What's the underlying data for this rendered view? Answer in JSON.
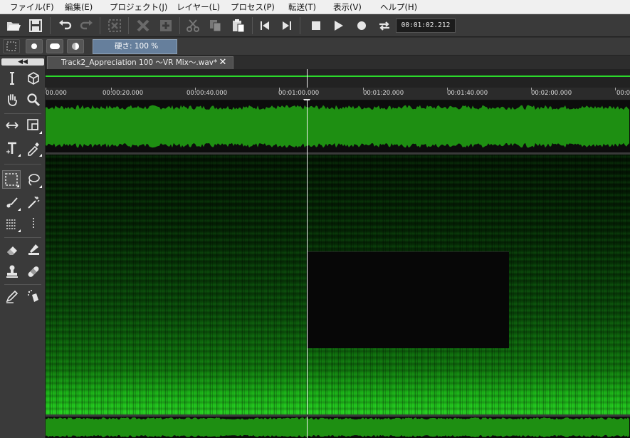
{
  "menu": [
    "ファイル(F)",
    "編集(E)",
    "プロジェクト(J)",
    "レイヤー(L)",
    "プロセス(P)",
    "転送(T)",
    "表示(V)",
    "ヘルプ(H)"
  ],
  "toolbar": {
    "icons": [
      "open-folder-icon",
      "save-icon",
      "undo-icon",
      "redo-icon",
      "deselect-icon",
      "delete-icon",
      "add-icon",
      "cut-icon",
      "copy-icon",
      "paste-icon",
      "skip-back-icon",
      "skip-forward-icon",
      "stop-icon",
      "play-icon",
      "record-icon",
      "loop-icon"
    ],
    "time": "00:01:02.212"
  },
  "brush": {
    "hardness_label": "硬さ: 100 %"
  },
  "tab": {
    "title": "Track2_Appreciation 100 ～VR Mix～.wav*",
    "close_glyph": "✕"
  },
  "ruler": {
    "labels": [
      "00.000",
      "00:00:20.000",
      "00:00:40.000",
      "00:01:00.000",
      "00:01:20.000",
      "00:01:40.000",
      "00:02:00.000",
      "00:02"
    ]
  },
  "colors": {
    "waveform": "#1e8f12",
    "overview_line": "#2bd92b",
    "playhead": "#f2f2f2",
    "spectrogram_bright": "#2ae624"
  }
}
